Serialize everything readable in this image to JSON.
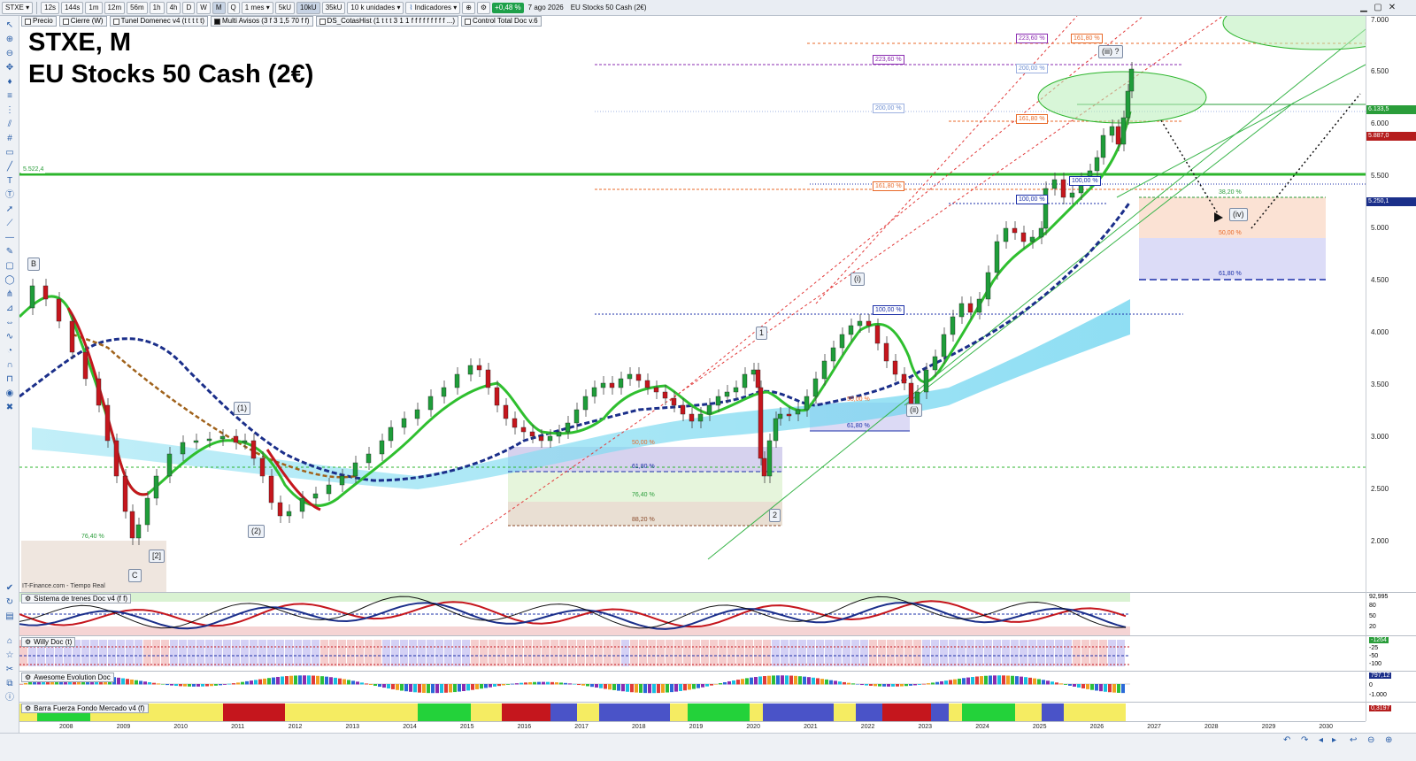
{
  "toolbar": {
    "symbol": "STXE",
    "timeframes": [
      "12s",
      "144s",
      "1m",
      "12m",
      "56m",
      "1h",
      "4h",
      "D",
      "W",
      "M",
      "Q"
    ],
    "active_timeframe": "M",
    "period": "1 mes",
    "units_a": "5kU",
    "units_b": "10kU",
    "units_c": "35kU",
    "units_select": "10 k unidades",
    "indicators_label": "Indicadores",
    "change_pct": "+0,48 %",
    "date": "7 ago 2026",
    "instrument": "EU Stocks 50 Cash (2€)",
    "icons": [
      "symbol-menu-icon",
      "chart-type-icon",
      "zoom-icon",
      "settings-icon"
    ]
  },
  "overlays": [
    {
      "label": "Precio",
      "filled": false
    },
    {
      "label": "Cierre (W)",
      "filled": false
    },
    {
      "label": "Tunel Domenec v4 (t t t t t)",
      "filled": false
    },
    {
      "label": "Multi Avisos (3 f 3 1,5 70 f f)",
      "filled": true
    },
    {
      "label": "DS_CotasHist (1 t t t 3 1 1 f f f f f f f f f ...)",
      "filled": false
    },
    {
      "label": "Control Total Doc v.6",
      "filled": false
    }
  ],
  "chart": {
    "title_line1": "STXE, M",
    "title_line2": "EU Stocks 50 Cash (2€)",
    "source": "IT-Finance.com - Tiempo Real",
    "support_label": "5.522,4",
    "colors": {
      "candle_up": "#1f9d3a",
      "candle_down": "#c5161d",
      "ema_fast": "#2fbf2f",
      "ema_slow": "#1b2f8a",
      "channel": "#e23b3b",
      "trendline": "#39b54a",
      "cloud": "#82dcf0"
    }
  },
  "price_axis": {
    "ticks": [
      "7.000",
      "6.500",
      "6.000",
      "5.500",
      "5.000",
      "4.500",
      "4.000",
      "3.500",
      "3.000",
      "2.500",
      "2.000"
    ],
    "tags": [
      {
        "text": "6.133,5",
        "color": "#2a9d3a"
      },
      {
        "text": "5.887,0",
        "color": "#b51d1d"
      },
      {
        "text": "5.250,1",
        "color": "#1b2f8a"
      }
    ]
  },
  "fib_levels": [
    {
      "text": "223,60 %",
      "color": "#8a2bb0"
    },
    {
      "text": "161,80 %",
      "color": "#e86a2a"
    },
    {
      "text": "223,60 %",
      "color": "#8a2bb0"
    },
    {
      "text": "200,00 %",
      "color": "#6b8dd1"
    },
    {
      "text": "200,00 %",
      "color": "#6b8dd1"
    },
    {
      "text": "161,80 %",
      "color": "#e86a2a"
    },
    {
      "text": "161,80 %",
      "color": "#e86a2a"
    },
    {
      "text": "100,00 %",
      "color": "#1b2fa8"
    },
    {
      "text": "100,00 %",
      "color": "#1b2fa8"
    },
    {
      "text": "100,00 %",
      "color": "#1b2fa8"
    },
    {
      "text": "38,20 %",
      "color": "#2a9d3a"
    },
    {
      "text": "50,00 %",
      "color": "#e86a2a"
    },
    {
      "text": "61,80 %",
      "color": "#1b2fa8"
    },
    {
      "text": "50,00 %",
      "color": "#e86a2a"
    },
    {
      "text": "61,80 %",
      "color": "#1b2fa8"
    },
    {
      "text": "76,40 %",
      "color": "#2a9d3a"
    },
    {
      "text": "88,20 %",
      "color": "#8a4a2a"
    },
    {
      "text": "50,00 %",
      "color": "#e86a2a"
    },
    {
      "text": "61,80 %",
      "color": "#1b2fa8"
    },
    {
      "text": "76,40 %",
      "color": "#2a9d3a"
    }
  ],
  "wave_labels": [
    "B",
    "C",
    "[2]",
    "(1)",
    "(2)",
    "1",
    "2",
    "(i)",
    "(ii)",
    "(iii) ?",
    "(iv)"
  ],
  "panes": [
    {
      "label": "Sistema de trenes Doc v4 (f f)",
      "axis": [
        "92,995",
        "80",
        "50",
        "20"
      ]
    },
    {
      "label": "Willy Doc (t)",
      "axis": [
        "-1264",
        "-25",
        "-50",
        "-100"
      ]
    },
    {
      "label": "Awesome Evolution Doc",
      "axis": [
        "797,12",
        "0",
        "-1.000"
      ]
    },
    {
      "label": "Barra Fuerza Fondo Mercado v4 (f)",
      "axis": [
        "0,3197"
      ]
    }
  ],
  "time_axis": [
    "2008",
    "2009",
    "2010",
    "2011",
    "2012",
    "2013",
    "2014",
    "2015",
    "2016",
    "2017",
    "2018",
    "2019",
    "2020",
    "2021",
    "2022",
    "2023",
    "2024",
    "2025",
    "2026",
    "2027",
    "2028",
    "2029",
    "2030"
  ]
}
